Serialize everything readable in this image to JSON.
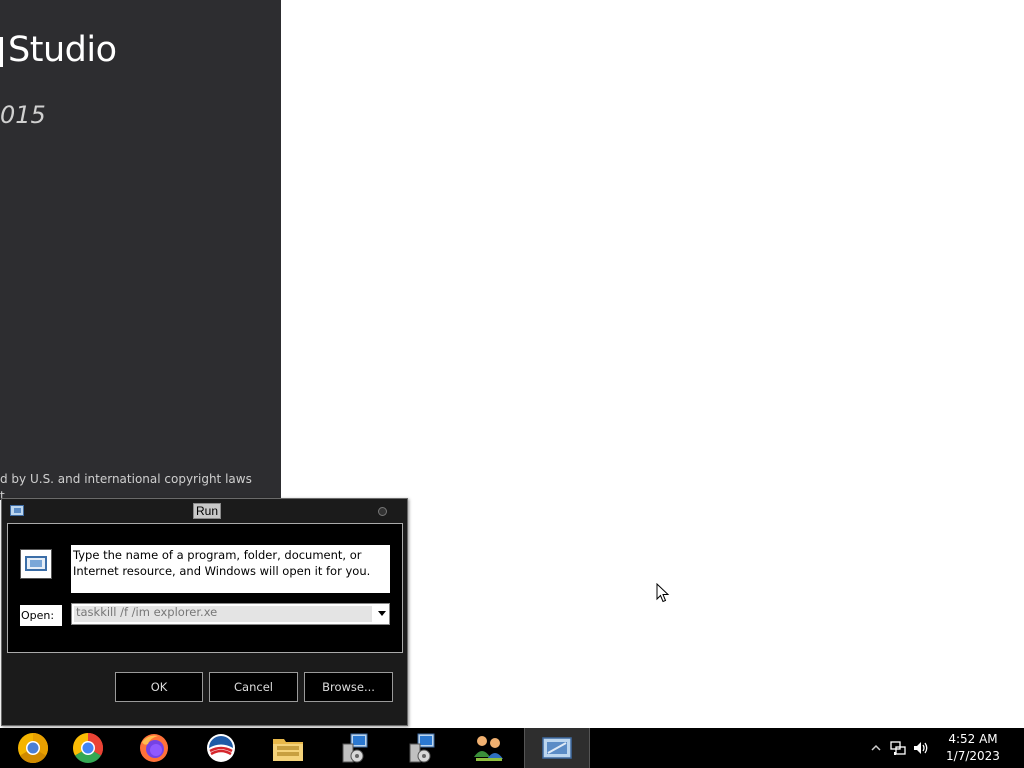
{
  "splash": {
    "title": "Studio",
    "year": "015",
    "legal_line1": "d by U.S. and international copyright laws",
    "legal_line2": "t"
  },
  "run_dialog": {
    "title": "Run",
    "description": "Type the name of a program, folder, document, or Internet resource, and Windows will open it for you.",
    "open_label": "Open:",
    "open_value": "taskkill /f /im explorer.xe",
    "ok_label": "OK",
    "cancel_label": "Cancel",
    "browse_label": "Browse..."
  },
  "taskbar": {
    "pinned": [
      {
        "icon": "chrome-canary-icon"
      },
      {
        "icon": "chrome-icon"
      },
      {
        "icon": "firefox-icon"
      },
      {
        "icon": "obama-logo-icon"
      },
      {
        "icon": "file-explorer-icon"
      },
      {
        "icon": "network-installer-icon"
      },
      {
        "icon": "network-installer-icon"
      },
      {
        "icon": "users-network-icon"
      },
      {
        "icon": "run-icon"
      }
    ],
    "clock": {
      "time": "4:52 AM",
      "date": "1/7/2023"
    }
  },
  "colors": {
    "splash_bg": "#2d2d30",
    "taskbar_bg": "#000000",
    "dialog_bg": "#1b1b1b"
  }
}
